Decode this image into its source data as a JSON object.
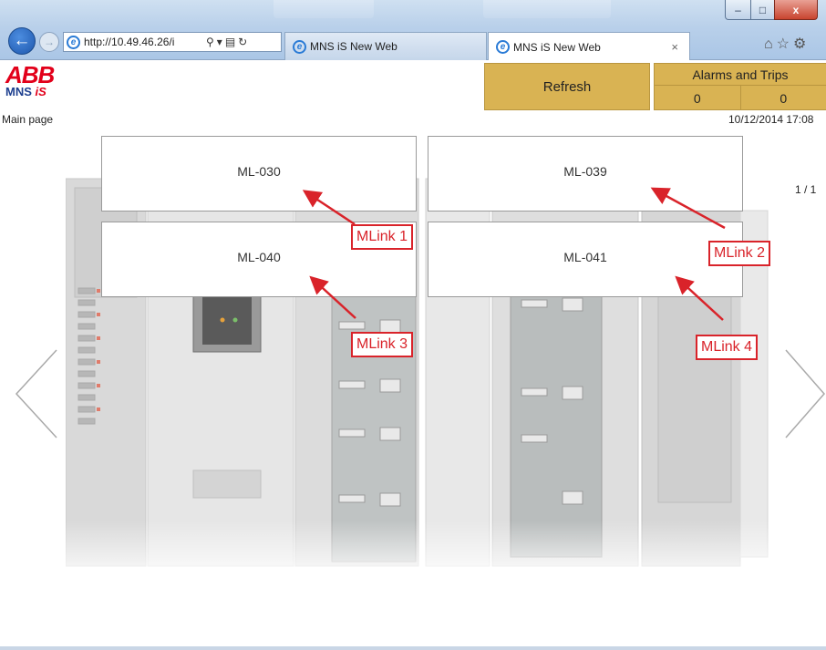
{
  "browser": {
    "address_url": "http://10.49.46.26/i",
    "tabs": [
      {
        "label": "MNS iS New Web",
        "active": false
      },
      {
        "label": "MNS iS New Web",
        "active": true
      }
    ],
    "tab_close": "×",
    "window_buttons": {
      "minimize": "–",
      "maximize": "□",
      "close": "x"
    }
  },
  "header": {
    "logo_brand": "ABB",
    "logo_product_prefix": "MNS ",
    "logo_product_suffix": "iS",
    "refresh_label": "Refresh",
    "alarms_title": "Alarms and Trips",
    "alarm_count": "0",
    "trip_count": "0",
    "page_label": "Main page",
    "datetime": "10/12/2014 17:08",
    "page_indicator": "1 / 1"
  },
  "mlinks": [
    {
      "label": "ML-030",
      "callout": "MLink 1"
    },
    {
      "label": "ML-039",
      "callout": "MLink 2"
    },
    {
      "label": "ML-040",
      "callout": "MLink 3"
    },
    {
      "label": "ML-041",
      "callout": "MLink 4"
    }
  ],
  "colors": {
    "accent_gold": "#d9b353",
    "callout_red": "#d9232a",
    "abb_red": "#e2001a"
  }
}
